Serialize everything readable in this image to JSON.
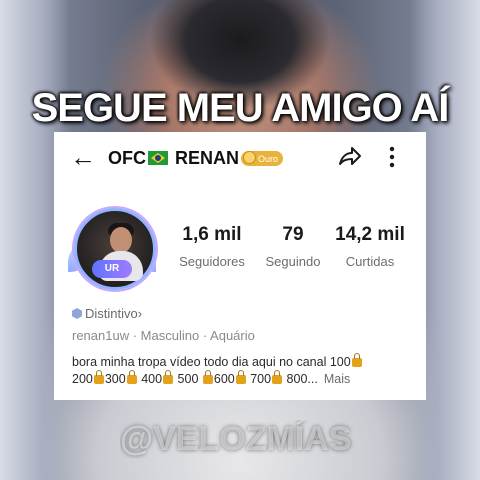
{
  "overlay": {
    "title": "SEGUE MEU AMIGO AÍ",
    "watermark": "@VELOZMÍAS"
  },
  "profile": {
    "name_prefix": "OFC",
    "name": "RENAN",
    "tier_badge": "Ouro",
    "avatar_tag": "UR",
    "stats": [
      {
        "value": "1,6 mil",
        "label": "Seguidores"
      },
      {
        "value": "79",
        "label": "Seguindo"
      },
      {
        "value": "14,2 mil",
        "label": "Curtidas"
      }
    ],
    "badge_link": "Distintivo",
    "badge_chevron": "›",
    "username": "renan1uw",
    "gender": "Masculino",
    "sign": "Aquário",
    "bio": {
      "line1": "bora minha tropa vídeo todo dia aqui no canal 100",
      "segments": [
        "200",
        "300",
        " 400",
        " 500 ",
        "600",
        " 700",
        " 800..."
      ],
      "more": "Mais"
    }
  },
  "icons": {
    "back": "arrow-left-icon",
    "share": "share-icon",
    "more": "more-vertical-icon",
    "verified": "hexagon-badge-icon",
    "lock": "lock-icon"
  },
  "colors": {
    "badge_gold": "#e9b23a",
    "lock_gold": "#e4a21a",
    "text_dark": "#1a1a1a",
    "text_muted": "#6d6d6d"
  }
}
